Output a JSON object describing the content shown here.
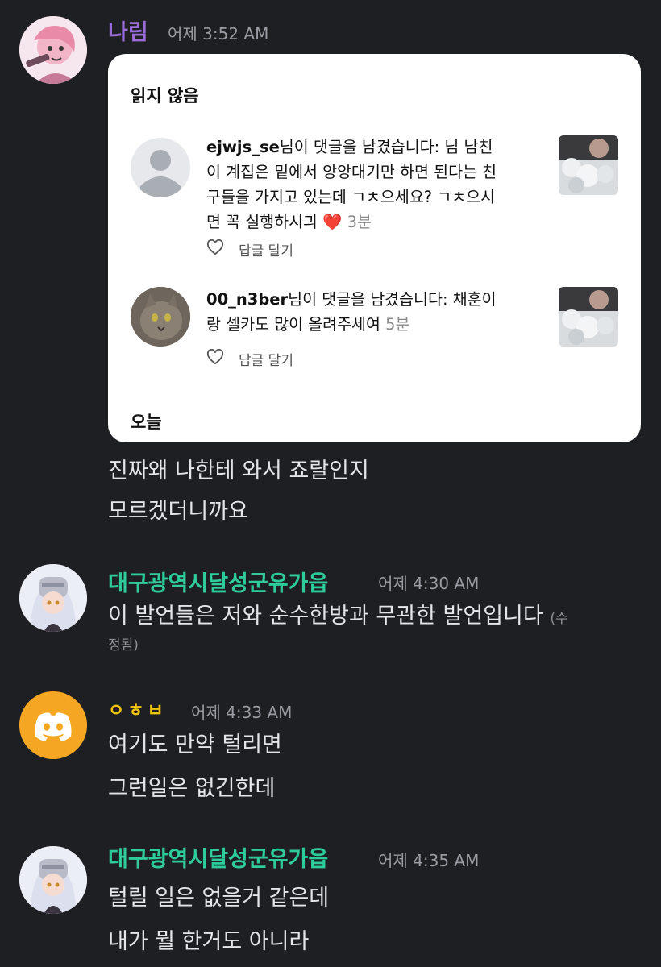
{
  "messages": [
    {
      "username": "나림",
      "username_color": "#8b5cf6",
      "timestamp": "어제 3:52 AM",
      "embed": {
        "section_unread": "읽지 않음",
        "section_today": "오늘",
        "notifications": [
          {
            "user": "ejwjs_se",
            "text_line1": "님이 댓글을 남겼습니다: 님 남친",
            "text_line2": "이 계집은 밑에서 앙앙대기만 하면 된다는 친",
            "text_line3": "구들을 가지고 있는데 ㄱㅊ으세요? ㄱㅊ으시",
            "text_line4": "면 꼭 실행하시긔 ❤️",
            "time": "3분",
            "reply_label": "답글 달기"
          },
          {
            "user": "00_n3ber",
            "text_line1": "님이 댓글을 남겼습니다: 채훈이",
            "text_line2": "랑 셀카도 많이 올려주세여",
            "time": "5분",
            "reply_label": "답글 달기"
          }
        ]
      },
      "lines": [
        "진짜왜 나한테 와서 죠랄인지",
        "모르겠더니까요"
      ]
    },
    {
      "username": "대구광역시달성군유가읍",
      "username_color": "#2ecc9a",
      "timestamp": "어제 4:30 AM",
      "lines": [
        "이 발언들은 저와 순수한방과 무관한 발언입니다"
      ],
      "edited_part1": "(수",
      "edited_part2": "정됨)"
    },
    {
      "username": "ㅇㅎㅂ",
      "username_color": "#f1c40f",
      "timestamp": "어제 4:33 AM",
      "avatar_bg": "#f5a623",
      "lines": [
        "여기도 만약 털리면",
        "그런일은 없긴한데"
      ]
    },
    {
      "username": "대구광역시달성군유가읍",
      "username_color": "#2ecc9a",
      "timestamp": "어제 4:35 AM",
      "lines": [
        "털릴 일은 없을거 같은데",
        "내가 뭘 한거도 아니라"
      ]
    }
  ]
}
